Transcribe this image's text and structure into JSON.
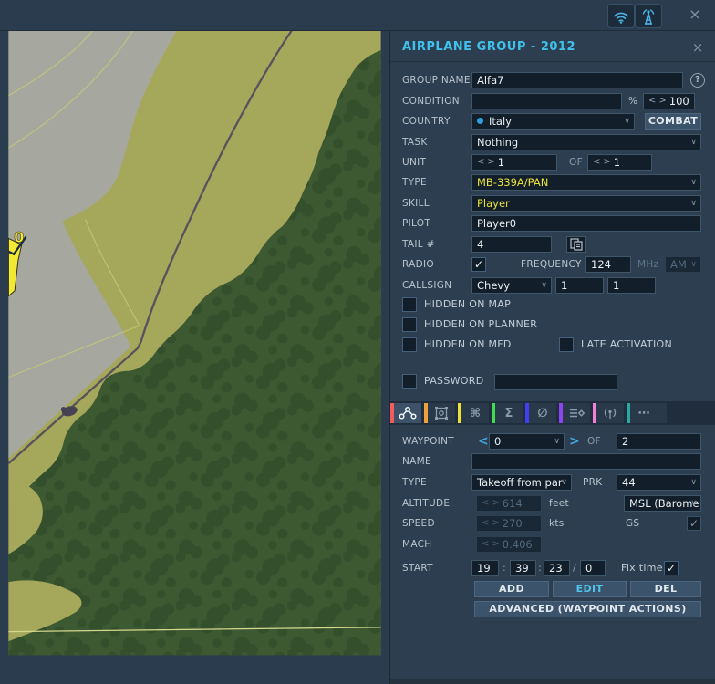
{
  "topbar": {
    "close": "×"
  },
  "glyphs": {
    "left": "<",
    "right": ">",
    "chevron": "∨",
    "check": "✓",
    "help": "?",
    "colon": ":",
    "slash": "/"
  },
  "panel": {
    "title": "AIRPLANE GROUP - 2012",
    "close": "×",
    "group_name": {
      "label": "GROUP NAME",
      "value": "Alfa7"
    },
    "condition": {
      "label": "CONDITION",
      "value": "",
      "percent": "%",
      "spin": "100"
    },
    "country": {
      "label": "COUNTRY",
      "value": "Italy",
      "combat": "COMBAT"
    },
    "task": {
      "label": "TASK",
      "value": "Nothing"
    },
    "unit": {
      "label": "UNIT",
      "count": "1",
      "of": "OF",
      "total": "1"
    },
    "type": {
      "label": "TYPE",
      "value": "MB-339A/PAN"
    },
    "skill": {
      "label": "SKILL",
      "value": "Player"
    },
    "pilot": {
      "label": "PILOT",
      "value": "Player0"
    },
    "tail": {
      "label": "TAIL #",
      "value": "4"
    },
    "radio": {
      "label": "RADIO",
      "frequency_label": "FREQUENCY",
      "frequency": "124",
      "mhz": "MHz",
      "modulation": "AM"
    },
    "callsign": {
      "label": "CALLSIGN",
      "value": "Chevy",
      "num1": "1",
      "num2": "1"
    },
    "hidden_on_map": "HIDDEN ON MAP",
    "hidden_on_planner": "HIDDEN ON PLANNER",
    "hidden_on_mfd": "HIDDEN ON MFD",
    "late_activation": "LATE ACTIVATION",
    "password": {
      "label": "PASSWORD",
      "value": ""
    },
    "checks": {
      "radio": true,
      "hidden_on_map": false,
      "hidden_on_planner": false,
      "hidden_on_mfd": false,
      "late_activation": false,
      "password": false,
      "gs": true,
      "fix_time": true
    }
  },
  "tabs": [
    {
      "name": "route",
      "color": "#f25c5c",
      "selected": true
    },
    {
      "name": "summary",
      "color": "#eda03c",
      "selected": false
    },
    {
      "name": "actions",
      "color": "#e8e23a",
      "selected": false,
      "glyph": "⌘"
    },
    {
      "name": "sum",
      "color": "#42d953",
      "selected": false,
      "glyph": "Σ"
    },
    {
      "name": "failures",
      "color": "#4040f2",
      "selected": false,
      "glyph": "∅"
    },
    {
      "name": "payload",
      "color": "#8c46f0",
      "selected": false
    },
    {
      "name": "radio",
      "color": "#f080d8",
      "selected": false
    },
    {
      "name": "more",
      "color": "#28a8a0",
      "selected": false,
      "glyph": "⋯"
    }
  ],
  "waypoint": {
    "label": "WAYPOINT",
    "value": "0",
    "of": "OF",
    "total": "2",
    "name": {
      "label": "NAME",
      "value": ""
    },
    "type": {
      "label": "TYPE",
      "value": "Takeoff from par",
      "prk_label": "PRK",
      "prk": "44"
    },
    "altitude": {
      "label": "ALTITUDE",
      "value": "614",
      "unit": "feet",
      "ref": "MSL (Barome"
    },
    "speed": {
      "label": "SPEED",
      "value": "270",
      "unit": "kts",
      "gs": "GS"
    },
    "mach": {
      "label": "MACH",
      "value": "0.406"
    },
    "start": {
      "label": "START",
      "h": "19",
      "m": "39",
      "s": "23",
      "d": "0",
      "fix_time": "Fix time"
    },
    "buttons": {
      "add": "ADD",
      "edit": "EDIT",
      "del": "DEL",
      "advanced": "ADVANCED (WAYPOINT ACTIONS)"
    }
  },
  "map": {
    "waypoint_marker": "0"
  },
  "colors": {
    "accent_cyan": "#3fc1ea",
    "value_yellow": "#e8e23a",
    "edit_cyan": "#4fc3ea",
    "map_grass": "#a5a75a",
    "map_forest": "#3d5932",
    "map_pavement": "#a6a8a0"
  }
}
